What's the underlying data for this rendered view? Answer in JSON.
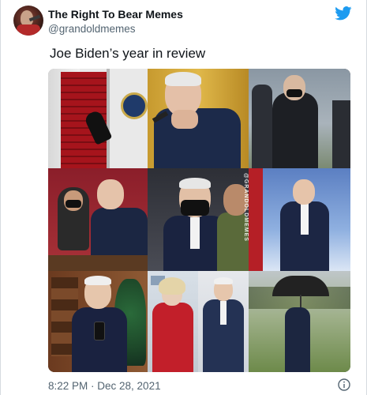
{
  "author": {
    "display_name": "The Right To Bear Memes",
    "handle": "@grandoldmemes"
  },
  "tweet": {
    "text": "Joe Biden’s year in review",
    "timestamp": "8:22 PM · Dec 28, 2021"
  },
  "media": {
    "watermark": "@GRANDOLDMEMES",
    "layout": "photo-collage",
    "tiles": [
      "stumbling-on-plane-stairs",
      "head-bowed-hands-clasped",
      "masked-hands-folded",
      "leaning-toward-child",
      "masked-in-crowd",
      "standing-before-flag",
      "selfie-with-phone",
      "woman-in-red-coat",
      "seated-in-suit",
      "walking-with-umbrella"
    ]
  },
  "icons": {
    "brand": "twitter-bird-icon",
    "info": "info-icon"
  },
  "colors": {
    "brand": "#1d9bf0",
    "text_primary": "#0f1419",
    "text_secondary": "#536471"
  }
}
